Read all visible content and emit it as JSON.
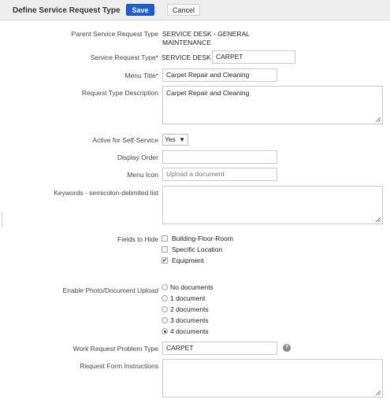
{
  "header": {
    "title": "Define Service Request Type",
    "save_label": "Save",
    "cancel_label": "Cancel"
  },
  "form": {
    "parent_label": "Parent Service Request Type",
    "parent_value_line1": "SERVICE DESK - GENERAL",
    "parent_value_line2": "MAINTENANCE",
    "type_label": "Service Request Type*",
    "type_prefix": "SERVICE DESK -",
    "type_value": "CARPET",
    "menu_title_label": "Menu Title*",
    "menu_title_value": "Carpet Repair and Cleaning",
    "description_label": "Request Type Description",
    "description_value": "Carpet Repair and Cleaning",
    "self_service_label": "Active for Self-Service",
    "self_service_value": "Yes",
    "display_order_label": "Display Order",
    "display_order_value": "",
    "menu_icon_label": "Menu Icon",
    "menu_icon_placeholder": "Upload a document",
    "keywords_label": "Keywords - semicolon-delimited list",
    "keywords_value": "",
    "fields_to_hide_label": "Fields to Hide",
    "fields_to_hide": [
      {
        "label": "Building-Floor-Room",
        "checked": false
      },
      {
        "label": "Specific Location",
        "checked": false
      },
      {
        "label": "Equipment",
        "checked": true
      }
    ],
    "upload_label": "Enable Photo/Document Upload",
    "upload_options": [
      {
        "label": "No documents",
        "selected": false
      },
      {
        "label": "1 document",
        "selected": false
      },
      {
        "label": "2 documents",
        "selected": false
      },
      {
        "label": "3 documents",
        "selected": false
      },
      {
        "label": "4 documents",
        "selected": true
      }
    ],
    "problem_type_label": "Work Request Problem Type",
    "problem_type_value": "CARPET",
    "help_glyph": "?",
    "instructions_label": "Request Form Instructions",
    "instructions_value": ""
  },
  "icons": {
    "dropdown": "triangle-down-icon",
    "help": "question-circle-icon",
    "checkmark": "check-icon"
  }
}
